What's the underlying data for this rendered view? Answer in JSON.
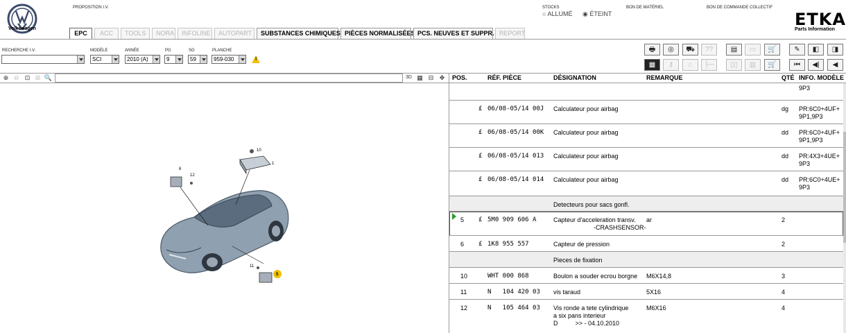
{
  "header": {
    "brand": "Volkswagen",
    "proposition": "PROPOSITION I.V.",
    "stocks_label": "STOCKS",
    "stock_on": "ALLUMÉ",
    "stock_off": "ÉTEINT",
    "bom_label": "BON DE MATÉRIEL",
    "order_label": "BON DE COMMANDE COLLECTIF",
    "app_name": "ETKA",
    "app_sub": "Parts Information"
  },
  "tabs": [
    "EPC",
    "ACC",
    "TOOLS",
    "NORA",
    "INFOLINE",
    "AUTOPART",
    "SUBSTANCES CHIMIQUES",
    "PIÈCES NORMALISÉES",
    "PCS. NEUVES ET SUPPR.",
    "REPORT"
  ],
  "filters": {
    "search_label": "RECHERCHE I.V.",
    "search_value": "",
    "model_label": "MODÈLE",
    "model_value": "SCI",
    "year_label": "ANNÉE",
    "year_value": "2010 (A)",
    "pg_label": "PG",
    "pg_value": "9",
    "sg_label": "SG",
    "sg_value": "59",
    "plate_label": "PLANCHE",
    "plate_value": "959-030"
  },
  "table": {
    "headers": {
      "pos": "POS.",
      "ref": "RÉF. PIÈCE",
      "designation": "DÉSIGNATION",
      "remark": "REMARQUE",
      "qty": "QTÉ",
      "info": "INFO. MODÈLE"
    },
    "top_info": "9P3",
    "rows": [
      {
        "pos": "",
        "f": "£",
        "ref": "06/08-05/14 00J",
        "desc": "Calculateur pour airbag",
        "desc2": "",
        "desc3": "",
        "remark": "",
        "qty": "dg",
        "info": "PR:6C0+4UF+",
        "info2": "9P1,9P3"
      },
      {
        "pos": "",
        "f": "£",
        "ref": "06/08-05/14 00K",
        "desc": "Calculateur pour airbag",
        "desc2": "",
        "desc3": "",
        "remark": "",
        "qty": "dd",
        "info": "PR:6C0+4UF+",
        "info2": "9P1,9P3"
      },
      {
        "pos": "",
        "f": "£",
        "ref": "06/08-05/14 013",
        "desc": "Calculateur pour airbag",
        "desc2": "",
        "desc3": "",
        "remark": "",
        "qty": "dd",
        "info": "PR:4X3+4UE+",
        "info2": "9P3"
      },
      {
        "pos": "",
        "f": "£",
        "ref": "06/08-05/14 014",
        "desc": "Calculateur pour airbag",
        "desc2": "",
        "desc3": "",
        "remark": "",
        "qty": "dd",
        "info": "PR:6C0+4UE+",
        "info2": "9P3"
      },
      {
        "pos": "",
        "f": "",
        "ref": "",
        "desc": "Detecteurs pour sacs gonfl.",
        "desc2": "",
        "desc3": "",
        "remark": "",
        "qty": "",
        "info": "",
        "info2": ""
      },
      {
        "pos": "5",
        "f": "£",
        "ref": "5M0 909 606 A",
        "desc": "Capteur d'acceleration transv.",
        "desc2": "-CRASHSENSOR-",
        "desc3": "",
        "remark": "ar",
        "qty": "2",
        "info": "",
        "info2": ""
      },
      {
        "pos": "6",
        "f": "£",
        "ref": "1K8 955 557",
        "desc": "Capteur de pression",
        "desc2": "",
        "desc3": "",
        "remark": "",
        "qty": "2",
        "info": "",
        "info2": ""
      },
      {
        "pos": "",
        "f": "",
        "ref": "",
        "desc": "Pieces de fixation",
        "desc2": "",
        "desc3": "",
        "remark": "",
        "qty": "",
        "info": "",
        "info2": ""
      },
      {
        "pos": "10",
        "f": "",
        "ref": "WHT 000 868",
        "desc": "Boulon a souder ecrou borgne",
        "desc2": "",
        "desc3": "",
        "remark": "M6X14,8",
        "qty": "3",
        "info": "",
        "info2": ""
      },
      {
        "pos": "11",
        "f": "",
        "ref": "N   104 420 03",
        "desc": "vis taraud",
        "desc2": "",
        "desc3": "",
        "remark": "5X16",
        "qty": "4",
        "info": "",
        "info2": ""
      },
      {
        "pos": "12",
        "f": "",
        "ref": "N   105 464 03",
        "desc": "Vis ronde a tete cylindrique",
        "desc2": "a six pans interieur",
        "desc3": "D          >> - 04.10.2010",
        "remark": "M6X16",
        "qty": "4",
        "info": "",
        "info2": ""
      }
    ]
  },
  "diagram": {
    "callouts": [
      "10",
      "1",
      "6",
      "12",
      "11",
      "5"
    ]
  },
  "colors": {
    "highlight": "#f0c000",
    "selected_marker": "#2a9a2a",
    "tab_border": "#9a9a9a"
  }
}
